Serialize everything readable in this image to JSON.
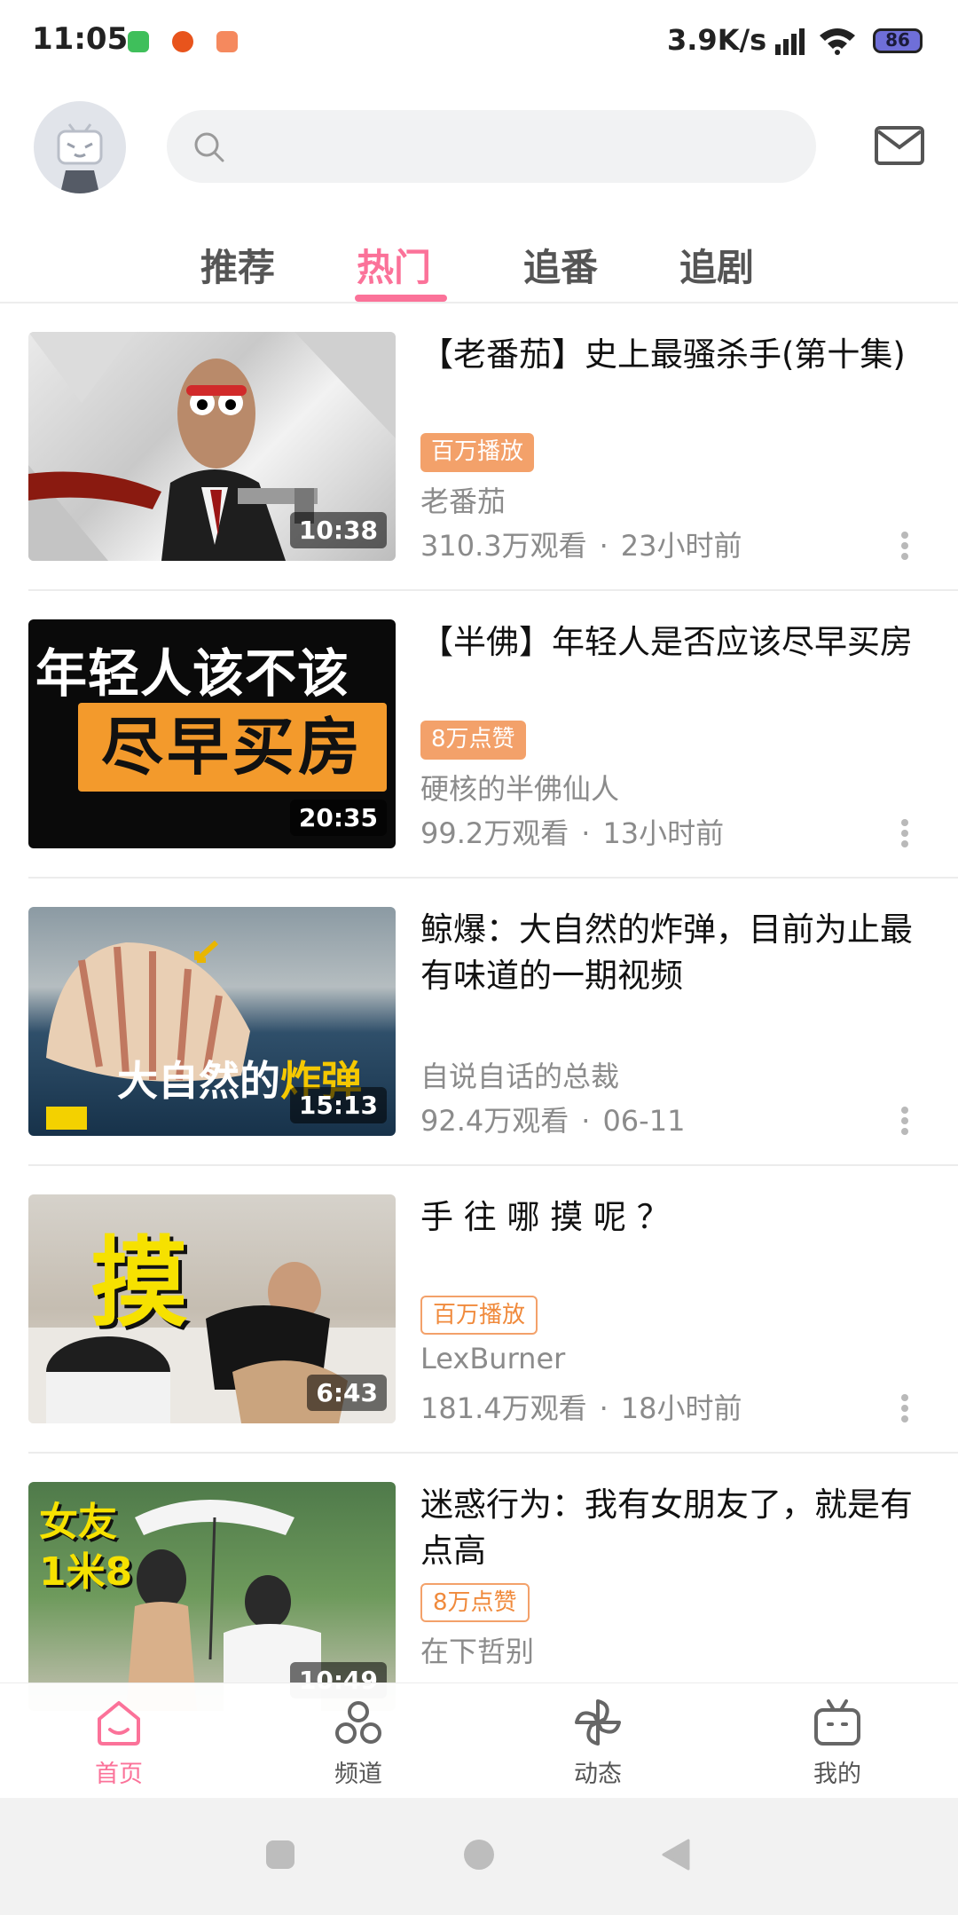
{
  "status_bar": {
    "time": "11:05",
    "net_speed": "3.9K/s",
    "battery": "86",
    "app_icons": [
      "wechat-icon",
      "game-icon",
      "taobao-icon"
    ]
  },
  "header": {
    "search_placeholder": "",
    "avatar_icon": "bilibili-tv-avatar-icon",
    "mail_icon": "mail-icon"
  },
  "tabs": {
    "items": [
      "推荐",
      "热门",
      "追番",
      "追剧"
    ],
    "active": "热门"
  },
  "videos": [
    {
      "title": "【老番茄】史上最骚杀手(第十集)",
      "badge": "百万播放",
      "badge_style": "solid",
      "uploader": "老番茄",
      "views": "310.3万观看",
      "time": "23小时前",
      "duration": "10:38"
    },
    {
      "title": "【半佛】年轻人是否应该尽早买房",
      "badge": "8万点赞",
      "badge_style": "solid",
      "uploader": "硬核的半佛仙人",
      "views": "99.2万观看",
      "time": "13小时前",
      "duration": "20:35",
      "thumb_text_1": "年轻人该不该",
      "thumb_text_2": "尽早买房"
    },
    {
      "title": "鲸爆：大自然的炸弹，目前为止最有味道的一期视频",
      "badge": "",
      "uploader": "自说自话的总裁",
      "views": "92.4万观看",
      "time": "06-11",
      "duration": "15:13",
      "thumb_text_1": "大自然的",
      "thumb_text_2": "炸弹"
    },
    {
      "title": "手 往 哪 摸 呢 ？",
      "badge": "百万播放",
      "badge_style": "outline",
      "uploader": "LexBurner",
      "views": "181.4万观看",
      "time": "18小时前",
      "duration": "6:43",
      "thumb_text_1": "摸"
    },
    {
      "title": "迷惑行为：我有女朋友了，就是有点高",
      "badge": "8万点赞",
      "badge_style": "outline",
      "uploader": "在下哲别",
      "views": "",
      "time": "",
      "duration": "10:49",
      "thumb_text_1": "女友",
      "thumb_text_2": "1米8"
    }
  ],
  "bottom_nav": {
    "items": [
      {
        "label": "首页",
        "icon": "home-icon"
      },
      {
        "label": "频道",
        "icon": "channel-icon"
      },
      {
        "label": "动态",
        "icon": "activity-icon"
      },
      {
        "label": "我的",
        "icon": "profile-tv-icon"
      }
    ],
    "active": "首页"
  },
  "colors": {
    "accent": "#fb7299",
    "badge": "#f3a16a"
  }
}
